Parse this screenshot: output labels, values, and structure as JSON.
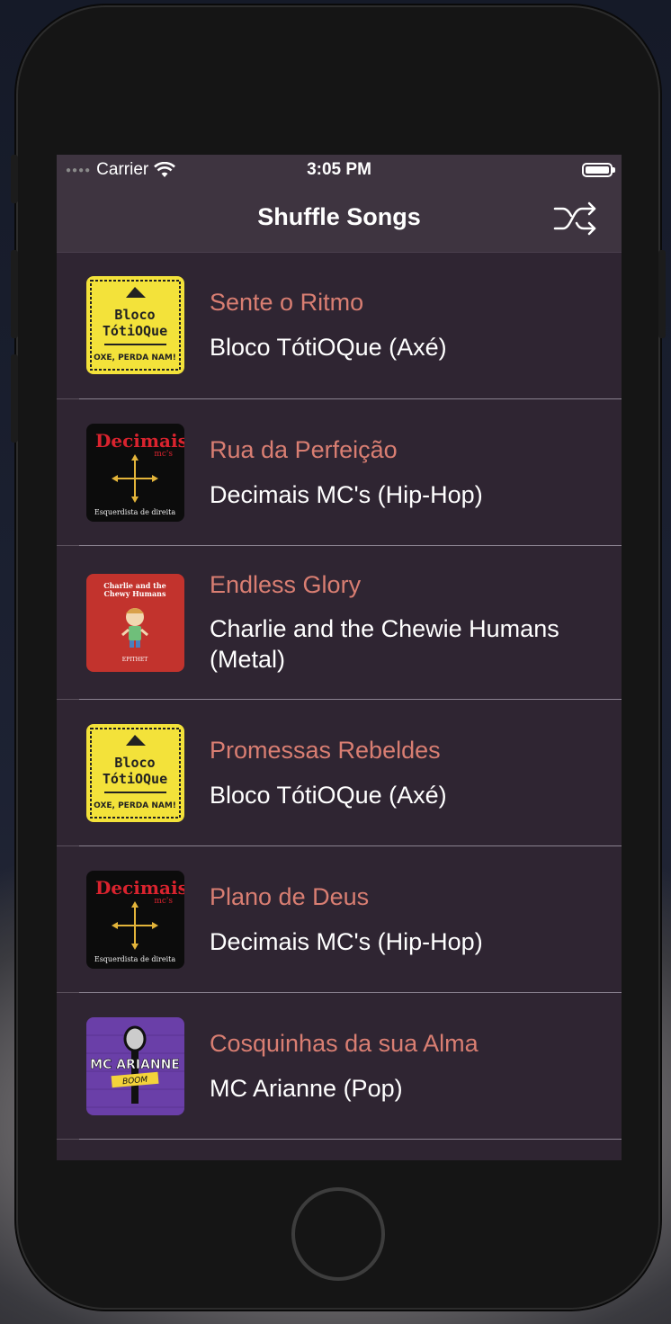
{
  "status_bar": {
    "carrier": "Carrier",
    "time": "3:05 PM",
    "battery_level": 1.0
  },
  "nav": {
    "title": "Shuffle Songs",
    "shuffle_icon": "shuffle-icon"
  },
  "songs": [
    {
      "title": "Sente o Ritmo",
      "artist": "Bloco TótiOQue (Axé)",
      "art": "bloco-totioque-cover"
    },
    {
      "title": "Rua da Perfeição",
      "artist": "Decimais MC's (Hip-Hop)",
      "art": "decimais-cover"
    },
    {
      "title": "Endless Glory",
      "artist": "Charlie and the Chewie Humans (Metal)",
      "art": "charlie-chewy-cover"
    },
    {
      "title": "Promessas Rebeldes",
      "artist": "Bloco TótiOQue (Axé)",
      "art": "bloco-totioque-cover"
    },
    {
      "title": "Plano de Deus",
      "artist": "Decimais MC's (Hip-Hop)",
      "art": "decimais-cover"
    },
    {
      "title": "Cosquinhas da sua Alma",
      "artist": "MC Arianne (Pop)",
      "art": "mc-arianne-cover"
    }
  ],
  "album_art_text": {
    "bloco": {
      "line1": "Bloco",
      "line2": "TótiOQue",
      "tagline": "OXE, PERDA NAM!"
    },
    "decimais": {
      "name": "Decimais",
      "sub": "mc's",
      "tagline": "Esquerdista de direita"
    },
    "charlie": {
      "name": "Charlie and the Chewy Humans",
      "label": "EPITHET"
    },
    "arianne": {
      "name": "MC ARIANNE",
      "sub": "BOOM"
    }
  },
  "colors": {
    "screen_bg": "#2f2532",
    "bar_bg": "#3e3440",
    "title_accent": "#d97e72"
  }
}
